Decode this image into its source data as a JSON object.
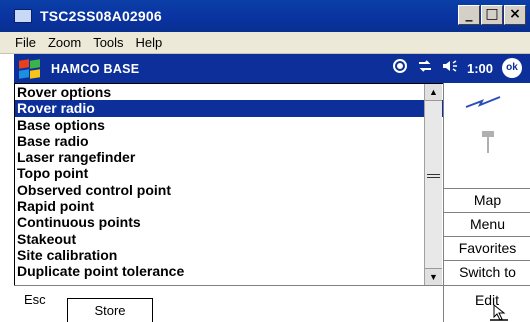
{
  "window": {
    "title": "TSC2SS08A02906",
    "min_icon": "_",
    "max_icon": "□",
    "close_icon": "×"
  },
  "menu": {
    "items": [
      "File",
      "Zoom",
      "Tools",
      "Help"
    ]
  },
  "taskbar": {
    "title": "HAMCO BASE",
    "time": "1:00",
    "ok_label": "ok",
    "icons": [
      "sync-icon",
      "connectivity-icon",
      "volume-icon"
    ]
  },
  "list": {
    "items": [
      "Rover options",
      "Rover radio",
      "Base options",
      "Base radio",
      "Laser rangefinder",
      "Topo point",
      "Observed control point",
      "Rapid point",
      "Continuous points",
      "Stakeout",
      "Site calibration",
      "Duplicate point tolerance"
    ],
    "selected_index": 1
  },
  "side_buttons": {
    "map": "Map",
    "menu": "Menu",
    "favorites": "Favorites",
    "switch_to": "Switch to"
  },
  "bottom": {
    "esc": "Esc",
    "store": "Store",
    "edit": "Edit"
  },
  "colors": {
    "title_bar": "#0b3fa8",
    "selection": "#0c2f9a"
  }
}
